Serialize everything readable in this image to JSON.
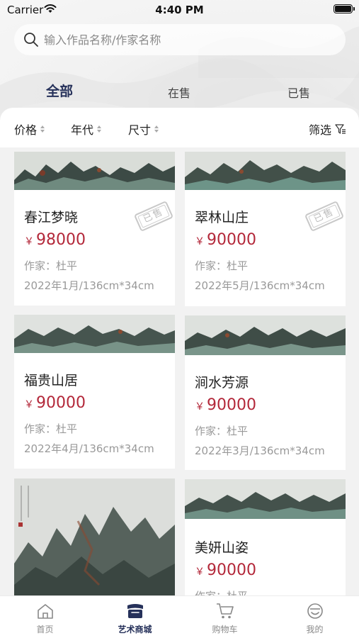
{
  "status_bar": {
    "carrier": "Carrier",
    "time": "4:40 PM"
  },
  "search": {
    "placeholder": "输入作品名称/作家名称",
    "value": ""
  },
  "tabs": [
    {
      "label": "全部",
      "active": true
    },
    {
      "label": "在售",
      "active": false
    },
    {
      "label": "已售",
      "active": false
    }
  ],
  "filters": {
    "sorts": [
      {
        "label": "价格"
      },
      {
        "label": "年代"
      },
      {
        "label": "尺寸"
      }
    ],
    "screen_label": "筛选"
  },
  "products": [
    {
      "title": "春江梦晓",
      "currency": "￥",
      "price": "98000",
      "artist": "作家：杜平",
      "meta": "2022年1月/136cm*34cm",
      "stamp": "已售"
    },
    {
      "title": "翠林山庄",
      "currency": "￥",
      "price": "90000",
      "artist": "作家：杜平",
      "meta": "2022年5月/136cm*34cm",
      "stamp": "已售"
    },
    {
      "title": "福贵山居",
      "currency": "￥",
      "price": "90000",
      "artist": "作家：杜平",
      "meta": "2022年4月/136cm*34cm"
    },
    {
      "title": "涧水芳源",
      "currency": "￥",
      "price": "90000",
      "artist": "作家：杜平",
      "meta": "2022年3月/136cm*34cm"
    },
    {
      "title": "",
      "currency": "",
      "price": "",
      "artist": "",
      "meta": ""
    },
    {
      "title": "美妍山姿",
      "currency": "￥",
      "price": "90000",
      "artist": "作家：杜平",
      "meta": ""
    }
  ],
  "tabbar": [
    {
      "label": "首页",
      "icon": "home-icon",
      "active": false
    },
    {
      "label": "艺术商城",
      "icon": "store-icon",
      "active": true
    },
    {
      "label": "购物车",
      "icon": "cart-icon",
      "active": false
    },
    {
      "label": "我的",
      "icon": "profile-icon",
      "active": false
    }
  ],
  "colors": {
    "accent": "#26315a",
    "price": "#b3283a",
    "muted": "#999999",
    "background": "#f2f2f2"
  }
}
